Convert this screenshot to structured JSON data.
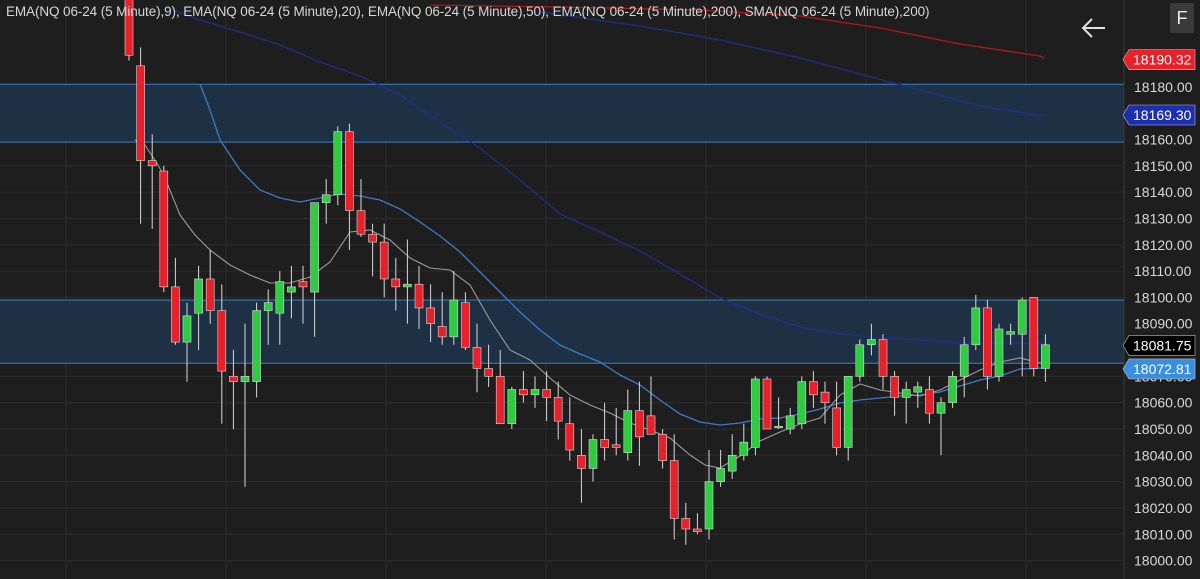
{
  "legend_text": "EMA(NQ 06-24 (5 Minute),9), EMA(NQ 06-24 (5 Minute),20), EMA(NQ 06-24 (5 Minute),50), EMA(NQ 06-24 (5 Minute),200), SMA(NQ 06-24 (5 Minute),200)",
  "corner_button": "F",
  "back_icon": "arrow-left-icon",
  "colors": {
    "background": "#1e1e1e",
    "grid": "#2c2c2c",
    "up": "#2ecc40",
    "down": "#e8202a",
    "zone_fill": "#1e3144",
    "zone_line": "#3d7fc4",
    "ema9": "#9a9a9a",
    "ema20": "#3a7bc8",
    "ema50": "#1c2f8a",
    "ema200": "#b01818",
    "axis_text": "#d8d8d8"
  },
  "chart_data": {
    "type": "candlestick",
    "ylim": [
      17993,
      18213
    ],
    "y_ticks": [
      18000,
      18010,
      18020,
      18030,
      18040,
      18050,
      18060,
      18070,
      18080,
      18090,
      18100,
      18110,
      18120,
      18130,
      18140,
      18150,
      18160,
      18170,
      18180
    ],
    "y_tick_labels": [
      "18000.00",
      "18010.00",
      "18020.00",
      "18030.00",
      "18040.00",
      "18050.00",
      "18060.00",
      "18070.00",
      "18080.00",
      "18090.00",
      "18100.00",
      "18110.00",
      "18120.00",
      "18130.00",
      "18140.00",
      "18150.00",
      "18160.00",
      "18170.00",
      "18180.00"
    ],
    "price_labels": [
      {
        "text": "18190.32",
        "value": 18190.32,
        "bg": "#e8202a",
        "fg": "#ffffff"
      },
      {
        "text": "18169.30",
        "value": 18169.3,
        "bg": "#1c2fb0",
        "fg": "#ffffff"
      },
      {
        "text": "18081.75",
        "value": 18081.75,
        "bg": "#000000",
        "fg": "#ffffff"
      },
      {
        "text": "18072.81",
        "value": 18072.81,
        "bg": "#3a8ee0",
        "fg": "#ffffff"
      }
    ],
    "zones": [
      {
        "top": 18181,
        "bottom": 18159
      },
      {
        "top": 18099,
        "bottom": 18075
      }
    ],
    "candles": [
      [
        18220,
        18225,
        18190,
        18192
      ],
      [
        18188,
        18195,
        18128,
        18152
      ],
      [
        18152,
        18162,
        18126,
        18150
      ],
      [
        18148,
        18150,
        18102,
        18104
      ],
      [
        18104,
        18115,
        18082,
        18083
      ],
      [
        18083,
        18098,
        18068,
        18093
      ],
      [
        18094,
        18112,
        18080,
        18107
      ],
      [
        18107,
        18118,
        18090,
        18095
      ],
      [
        18095,
        18105,
        18052,
        18072
      ],
      [
        18070,
        18080,
        18050,
        18068
      ],
      [
        18068,
        18090,
        18028,
        18070
      ],
      [
        18068,
        18098,
        18062,
        18095
      ],
      [
        18095,
        18103,
        18082,
        18098
      ],
      [
        18094,
        18110,
        18082,
        18106
      ],
      [
        18102,
        18112,
        18092,
        18104
      ],
      [
        18106,
        18112,
        18090,
        18104
      ],
      [
        18102,
        18122,
        18085,
        18136
      ],
      [
        18136,
        18145,
        18128,
        18139
      ],
      [
        18139,
        18165,
        18135,
        18163
      ],
      [
        18163,
        18166,
        18118,
        18133
      ],
      [
        18133,
        18145,
        18123,
        18124
      ],
      [
        18124,
        18128,
        18108,
        18121
      ],
      [
        18121,
        18128,
        18100,
        18107
      ],
      [
        18107,
        18115,
        18095,
        18104
      ],
      [
        18104,
        18122,
        18090,
        18105
      ],
      [
        18105,
        18112,
        18088,
        18096
      ],
      [
        18096,
        18105,
        18083,
        18090
      ],
      [
        18089,
        18102,
        18082,
        18085
      ],
      [
        18085,
        18110,
        18082,
        18099
      ],
      [
        18098,
        18102,
        18080,
        18081
      ],
      [
        18081,
        18090,
        18064,
        18073
      ],
      [
        18073,
        18082,
        18066,
        18070
      ],
      [
        18070,
        18080,
        18053,
        18052
      ],
      [
        18052,
        18066,
        18050,
        18065
      ],
      [
        18065,
        18072,
        18060,
        18063
      ],
      [
        18063,
        18070,
        18058,
        18065
      ],
      [
        18065,
        18072,
        18053,
        18062
      ],
      [
        18062,
        18068,
        18046,
        18053
      ],
      [
        18052,
        18062,
        18038,
        18042
      ],
      [
        18040,
        18050,
        18022,
        18035
      ],
      [
        18035,
        18048,
        18030,
        18046
      ],
      [
        18046,
        18060,
        18038,
        18043
      ],
      [
        18044,
        18058,
        18040,
        18043
      ],
      [
        18041,
        18065,
        18038,
        18057
      ],
      [
        18057,
        18068,
        18036,
        18047
      ],
      [
        18055,
        18070,
        18048,
        18048
      ],
      [
        18048,
        18050,
        18035,
        18038
      ],
      [
        18038,
        18048,
        18008,
        18016
      ],
      [
        18016,
        18022,
        18006,
        18012
      ],
      [
        18012,
        18018,
        18010,
        18011
      ],
      [
        18012,
        18042,
        18008,
        18030
      ],
      [
        18030,
        18042,
        18028,
        18035
      ],
      [
        18034,
        18048,
        18031,
        18040
      ],
      [
        18040,
        18052,
        18038,
        18045
      ],
      [
        18043,
        18070,
        18040,
        18069
      ],
      [
        18069,
        18070,
        18055,
        18050
      ],
      [
        18051,
        18062,
        18050,
        18051
      ],
      [
        18050,
        18058,
        18048,
        18055
      ],
      [
        18052,
        18070,
        18050,
        18068
      ],
      [
        18068,
        18072,
        18058,
        18063
      ],
      [
        18064,
        18068,
        18052,
        18060
      ],
      [
        18058,
        18068,
        18040,
        18043
      ],
      [
        18043,
        18070,
        18038,
        18070
      ],
      [
        18070,
        18084,
        18068,
        18082
      ],
      [
        18082,
        18090,
        18078,
        18084
      ],
      [
        18084,
        18086,
        18065,
        18070
      ],
      [
        18070,
        18072,
        18055,
        18062
      ],
      [
        18062,
        18068,
        18052,
        18065
      ],
      [
        18064,
        18068,
        18058,
        18066
      ],
      [
        18065,
        18070,
        18052,
        18056
      ],
      [
        18056,
        18062,
        18040,
        18060
      ],
      [
        18060,
        18072,
        18058,
        18070
      ],
      [
        18070,
        18085,
        18062,
        18082
      ],
      [
        18082,
        18101,
        18080,
        18096
      ],
      [
        18096,
        18099,
        18065,
        18070
      ],
      [
        18070,
        18090,
        18068,
        18088
      ],
      [
        18086,
        18090,
        18082,
        18087
      ],
      [
        18086,
        18100,
        18070,
        18099
      ],
      [
        18100,
        18100,
        18070,
        18073
      ],
      [
        18073,
        18086,
        18068,
        18082
      ]
    ],
    "ema9": [
      [
        135,
        140
      ],
      [
        145,
        145
      ],
      [
        158,
        165
      ],
      [
        165,
        178
      ],
      [
        180,
        215
      ],
      [
        195,
        235
      ],
      [
        210,
        250
      ],
      [
        230,
        265
      ],
      [
        250,
        275
      ],
      [
        270,
        283
      ],
      [
        290,
        283
      ],
      [
        310,
        277
      ],
      [
        330,
        262
      ],
      [
        350,
        232
      ],
      [
        370,
        230
      ],
      [
        390,
        240
      ],
      [
        410,
        258
      ],
      [
        430,
        268
      ],
      [
        450,
        270
      ],
      [
        470,
        285
      ],
      [
        490,
        320
      ],
      [
        510,
        350
      ],
      [
        530,
        360
      ],
      [
        550,
        378
      ],
      [
        570,
        395
      ],
      [
        590,
        405
      ],
      [
        610,
        413
      ],
      [
        630,
        423
      ],
      [
        650,
        430
      ],
      [
        670,
        438
      ],
      [
        690,
        455
      ],
      [
        705,
        465
      ],
      [
        720,
        468
      ],
      [
        740,
        456
      ],
      [
        760,
        441
      ],
      [
        780,
        432
      ],
      [
        800,
        424
      ],
      [
        820,
        418
      ],
      [
        840,
        395
      ],
      [
        860,
        384
      ],
      [
        880,
        390
      ],
      [
        900,
        393
      ],
      [
        920,
        396
      ],
      [
        940,
        390
      ],
      [
        960,
        380
      ],
      [
        980,
        370
      ],
      [
        1000,
        362
      ],
      [
        1020,
        358
      ],
      [
        1044,
        364
      ]
    ],
    "ema20": [
      [
        200,
        84
      ],
      [
        210,
        110
      ],
      [
        220,
        140
      ],
      [
        240,
        170
      ],
      [
        260,
        190
      ],
      [
        280,
        198
      ],
      [
        300,
        202
      ],
      [
        320,
        198
      ],
      [
        340,
        194
      ],
      [
        360,
        196
      ],
      [
        380,
        200
      ],
      [
        400,
        209
      ],
      [
        420,
        222
      ],
      [
        440,
        236
      ],
      [
        460,
        252
      ],
      [
        480,
        272
      ],
      [
        500,
        292
      ],
      [
        520,
        312
      ],
      [
        540,
        330
      ],
      [
        560,
        345
      ],
      [
        580,
        354
      ],
      [
        600,
        362
      ],
      [
        620,
        375
      ],
      [
        640,
        385
      ],
      [
        660,
        400
      ],
      [
        680,
        414
      ],
      [
        700,
        422
      ],
      [
        720,
        425
      ],
      [
        740,
        423
      ],
      [
        760,
        419
      ],
      [
        780,
        418
      ],
      [
        800,
        414
      ],
      [
        820,
        409
      ],
      [
        840,
        403
      ],
      [
        860,
        400
      ],
      [
        880,
        398
      ],
      [
        900,
        396
      ],
      [
        920,
        395
      ],
      [
        940,
        392
      ],
      [
        960,
        386
      ],
      [
        980,
        380
      ],
      [
        1000,
        376
      ],
      [
        1020,
        369
      ],
      [
        1044,
        368
      ]
    ],
    "ema50": [
      [
        168,
        8
      ],
      [
        200,
        20
      ],
      [
        240,
        32
      ],
      [
        280,
        45
      ],
      [
        320,
        62
      ],
      [
        360,
        76
      ],
      [
        400,
        95
      ],
      [
        440,
        122
      ],
      [
        480,
        148
      ],
      [
        520,
        180
      ],
      [
        560,
        214
      ],
      [
        600,
        232
      ],
      [
        640,
        251
      ],
      [
        680,
        274
      ],
      [
        720,
        298
      ],
      [
        760,
        314
      ],
      [
        800,
        327
      ],
      [
        840,
        334
      ],
      [
        880,
        338
      ],
      [
        920,
        340
      ],
      [
        960,
        343
      ],
      [
        1000,
        343
      ],
      [
        1020,
        343
      ],
      [
        1044,
        344
      ]
    ],
    "ema200": [
      [
        430,
        5
      ],
      [
        560,
        7
      ],
      [
        700,
        10
      ],
      [
        800,
        16
      ],
      [
        880,
        28
      ],
      [
        960,
        44
      ],
      [
        1040,
        56
      ],
      [
        1044,
        58
      ]
    ],
    "sma200": [
      [
        540,
        12
      ],
      [
        640,
        26
      ],
      [
        720,
        40
      ],
      [
        800,
        58
      ],
      [
        860,
        74
      ],
      [
        920,
        90
      ],
      [
        980,
        106
      ],
      [
        1044,
        116
      ]
    ]
  }
}
